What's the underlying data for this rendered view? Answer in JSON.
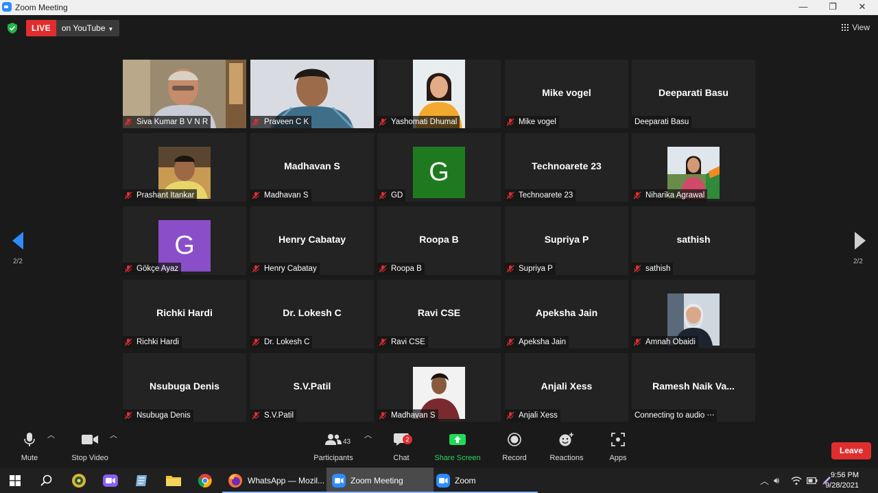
{
  "window": {
    "title": "Zoom Meeting",
    "minimize": "—",
    "restore": "❐",
    "close": "✕"
  },
  "topbar": {
    "live_badge": "LIVE",
    "stream_target": "on YouTube",
    "view_label": "View"
  },
  "pager": {
    "left_label": "2/2",
    "right_label": "2/2"
  },
  "colors": {
    "accent": "#2d8cff",
    "danger": "#e02e2e",
    "share_green": "#23d959",
    "avatar_green": "#1f7a1f",
    "avatar_purple": "#8a4fc8"
  },
  "grid": {
    "rows": [
      [
        {
          "name": "Siva Kumar B V N R",
          "kind": "photo",
          "photo": "man-office"
        },
        {
          "name": "Praveen C K",
          "kind": "photo",
          "photo": "young-man"
        },
        {
          "name": "Yashomati Dhumal",
          "kind": "photo",
          "photo": "woman-yellow"
        },
        {
          "name": "Mike vogel",
          "kind": "text",
          "display": "Mike vogel"
        },
        {
          "name": "Deeparati Basu",
          "kind": "text",
          "display": "Deeparati Basu",
          "muted": false
        }
      ],
      [
        {
          "name": "Prashant Itankar",
          "kind": "photo",
          "photo": "man-yellow"
        },
        {
          "name": "Madhavan S",
          "kind": "text",
          "display": "Madhavan S"
        },
        {
          "name": "GD",
          "kind": "letter",
          "letter": "G",
          "color": "#1f7a1f"
        },
        {
          "name": "Technoarete 23",
          "kind": "text",
          "display": "Technoarete 23"
        },
        {
          "name": "Niharika Agrawal",
          "kind": "photo",
          "photo": "woman-flag"
        }
      ],
      [
        {
          "name": "Gökçe Ayaz",
          "kind": "letter",
          "letter": "G",
          "color": "#8a4fc8"
        },
        {
          "name": "Henry Cabatay",
          "kind": "text",
          "display": "Henry Cabatay"
        },
        {
          "name": "Roopa B",
          "kind": "text",
          "display": "Roopa B"
        },
        {
          "name": "Supriya P",
          "kind": "text",
          "display": "Supriya P"
        },
        {
          "name": "sathish",
          "kind": "text",
          "display": "sathish"
        }
      ],
      [
        {
          "name": "Richki Hardi",
          "kind": "text",
          "display": "Richki Hardi"
        },
        {
          "name": "Dr. Lokesh C",
          "kind": "text",
          "display": "Dr. Lokesh C"
        },
        {
          "name": "Ravi CSE",
          "kind": "text",
          "display": "Ravi CSE"
        },
        {
          "name": "Apeksha Jain",
          "kind": "text",
          "display": "Apeksha Jain"
        },
        {
          "name": "Amnah Obaidi",
          "kind": "photo",
          "photo": "woman-scarf"
        }
      ],
      [
        {
          "name": "Nsubuga Denis",
          "kind": "text",
          "display": "Nsubuga Denis"
        },
        {
          "name": "S.V.Patil",
          "kind": "text",
          "display": "S.V.Patil"
        },
        {
          "name": "Madhavan S",
          "kind": "photo",
          "photo": "man-maroon"
        },
        {
          "name": "Anjali Xess",
          "kind": "text",
          "display": "Anjali Xess"
        },
        {
          "name": "Connecting to audio ⋅⋅⋅",
          "kind": "text",
          "display": "Ramesh  Naik Va...",
          "muted": false
        }
      ]
    ]
  },
  "toolbar": {
    "mute": "Mute",
    "stop_video": "Stop Video",
    "participants": "Participants",
    "participants_count": "43",
    "chat": "Chat",
    "chat_badge": "2",
    "share_screen": "Share Screen",
    "record": "Record",
    "reactions": "Reactions",
    "apps": "Apps",
    "leave": "Leave"
  },
  "taskbar": {
    "apps": [
      {
        "label": "WhatsApp — Mozil...",
        "icon": "firefox-icon"
      },
      {
        "label": "Zoom Meeting",
        "icon": "zoom-icon",
        "active": true
      },
      {
        "label": "Zoom",
        "icon": "zoom-icon"
      }
    ],
    "time": "9:56 PM",
    "date": "9/28/2021"
  }
}
